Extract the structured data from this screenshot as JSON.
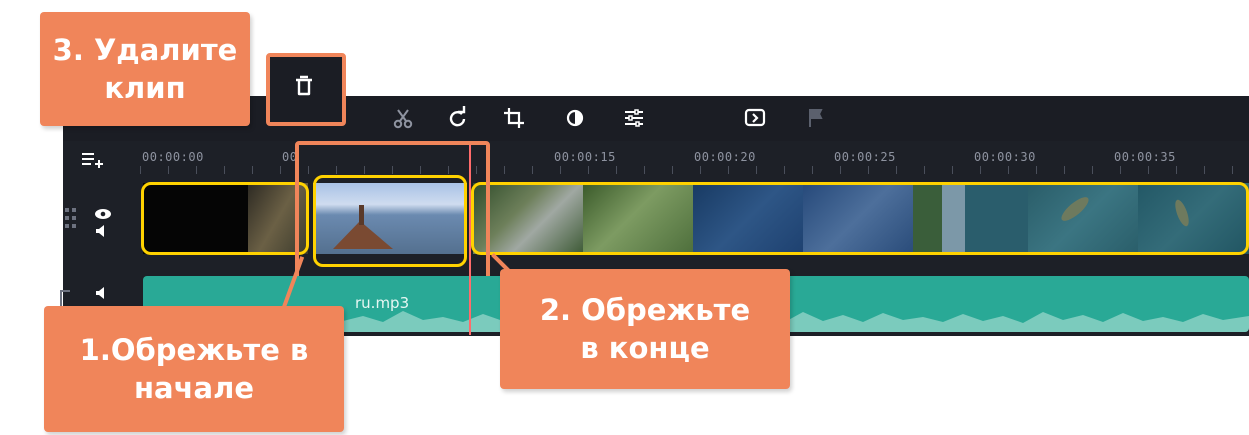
{
  "timeline": {
    "timecodes": [
      "00:00:00",
      "00",
      "00:00:15",
      "00:00:20",
      "00:00:25",
      "00:00:30",
      "00:00:35"
    ],
    "audio_file": "ru.mp3"
  },
  "toolbar": {
    "tools": [
      "delete-icon",
      "scissors-icon",
      "rotate-icon",
      "crop-icon",
      "color-adjust-icon",
      "settings-sliders-icon",
      "transition-icon",
      "flag-icon"
    ]
  },
  "callouts": {
    "delete": "3. Удалите\nклип",
    "trim_start": "1.Обрежьте в\nначале",
    "trim_end": "2. Обрежьте\nв конце"
  },
  "colors": {
    "accent": "#f0855a",
    "clip_outline": "#ffd200",
    "audio": "#29a996",
    "panel": "#1d2027"
  }
}
